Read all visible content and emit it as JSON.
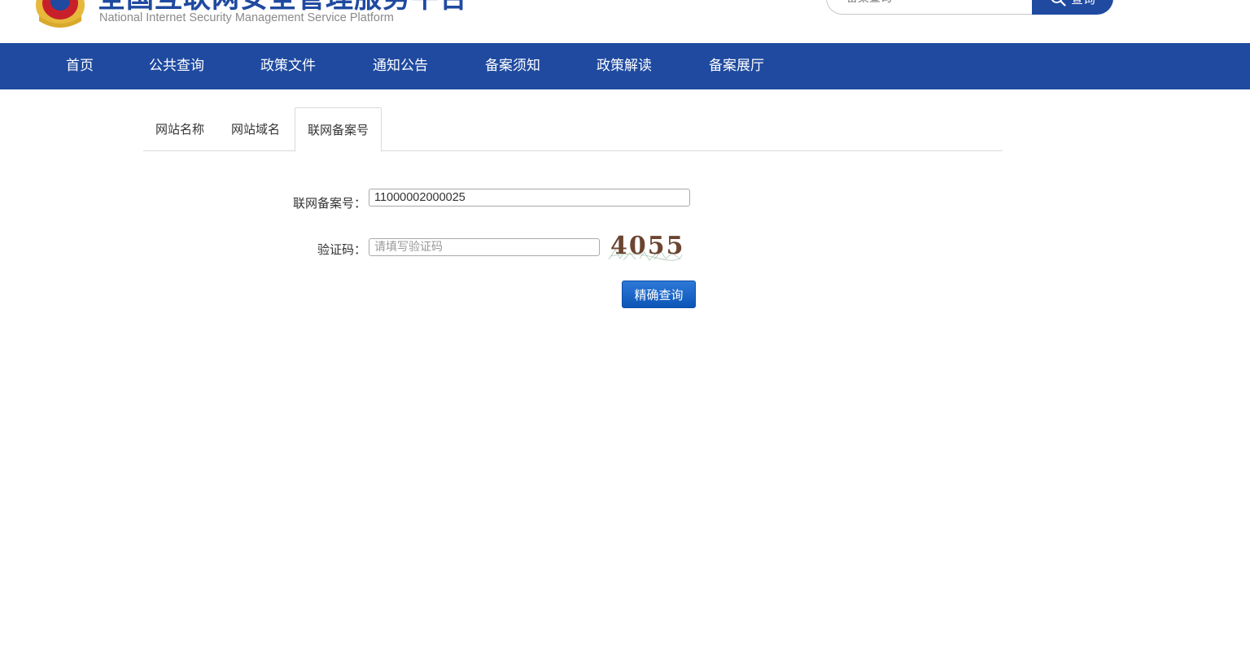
{
  "header": {
    "title": "全国互联网安全管理服务平台",
    "subtitle": "National Internet Security Management Service Platform",
    "search_placeholder": "备案查询",
    "search_button": "查询"
  },
  "nav": {
    "items": [
      {
        "label": "首页"
      },
      {
        "label": "公共查询"
      },
      {
        "label": "政策文件"
      },
      {
        "label": "通知公告"
      },
      {
        "label": "备案须知"
      },
      {
        "label": "政策解读"
      },
      {
        "label": "备案展厅"
      }
    ]
  },
  "tabs": {
    "items": [
      {
        "label": "网站名称",
        "active": false
      },
      {
        "label": "网站域名",
        "active": false
      },
      {
        "label": "联网备案号",
        "active": true
      }
    ]
  },
  "form": {
    "record_label": "联网备案号：",
    "record_value": "11000002000025",
    "captcha_label": "验证码：",
    "captcha_placeholder": "请填写验证码",
    "captcha_code": "4055",
    "submit_label": "精确查询"
  },
  "colors": {
    "brand_blue": "#1f4aa0",
    "button_blue": "#0b55b8"
  }
}
